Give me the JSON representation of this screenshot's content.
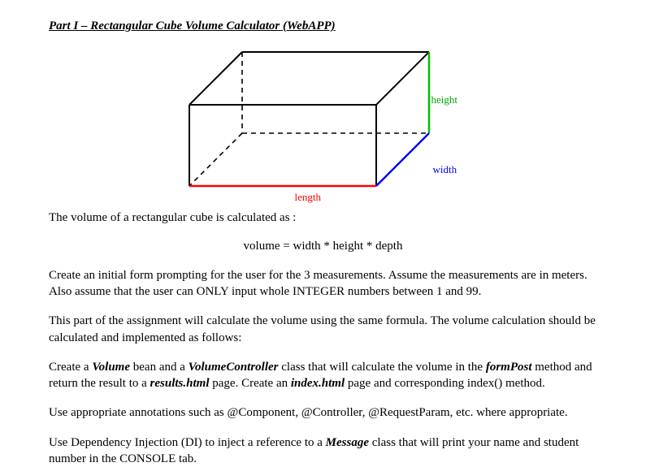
{
  "title": "Part I – Rectangular Cube Volume Calculator (WebAPP)",
  "diagram": {
    "height_label": "height",
    "width_label": "width",
    "length_label": "length"
  },
  "intro": "The volume of a rectangular cube is calculated as :",
  "formula": "volume = width * height * depth",
  "p1": "Create an initial form prompting for the user for the 3 measurements. Assume the measurements are in meters. Also assume that the user can ONLY input whole INTEGER numbers between 1 and 99.",
  "p2": "This part of the assignment will calculate the volume using the same formula. The volume calculation should be calculated and implemented as follows:",
  "p3": {
    "t1": "Create a ",
    "b1": "Volume",
    "t2": " bean and a ",
    "b2": "VolumeController",
    "t3": " class that will calculate the volume in the ",
    "b3": "formPost",
    "t4": " method and return the result to a ",
    "b4": "results.html",
    "t5": " page. Create an ",
    "b5": "index.html",
    "t6": " page and corresponding index() method."
  },
  "p4": "Use appropriate annotations such as @Component, @Controller, @RequestParam, etc. where appropriate.",
  "p5": {
    "t1": "Use Dependency Injection (DI) to inject a reference to a ",
    "b1": "Message",
    "t2": " class that will print your name and student number in the CONSOLE tab."
  }
}
